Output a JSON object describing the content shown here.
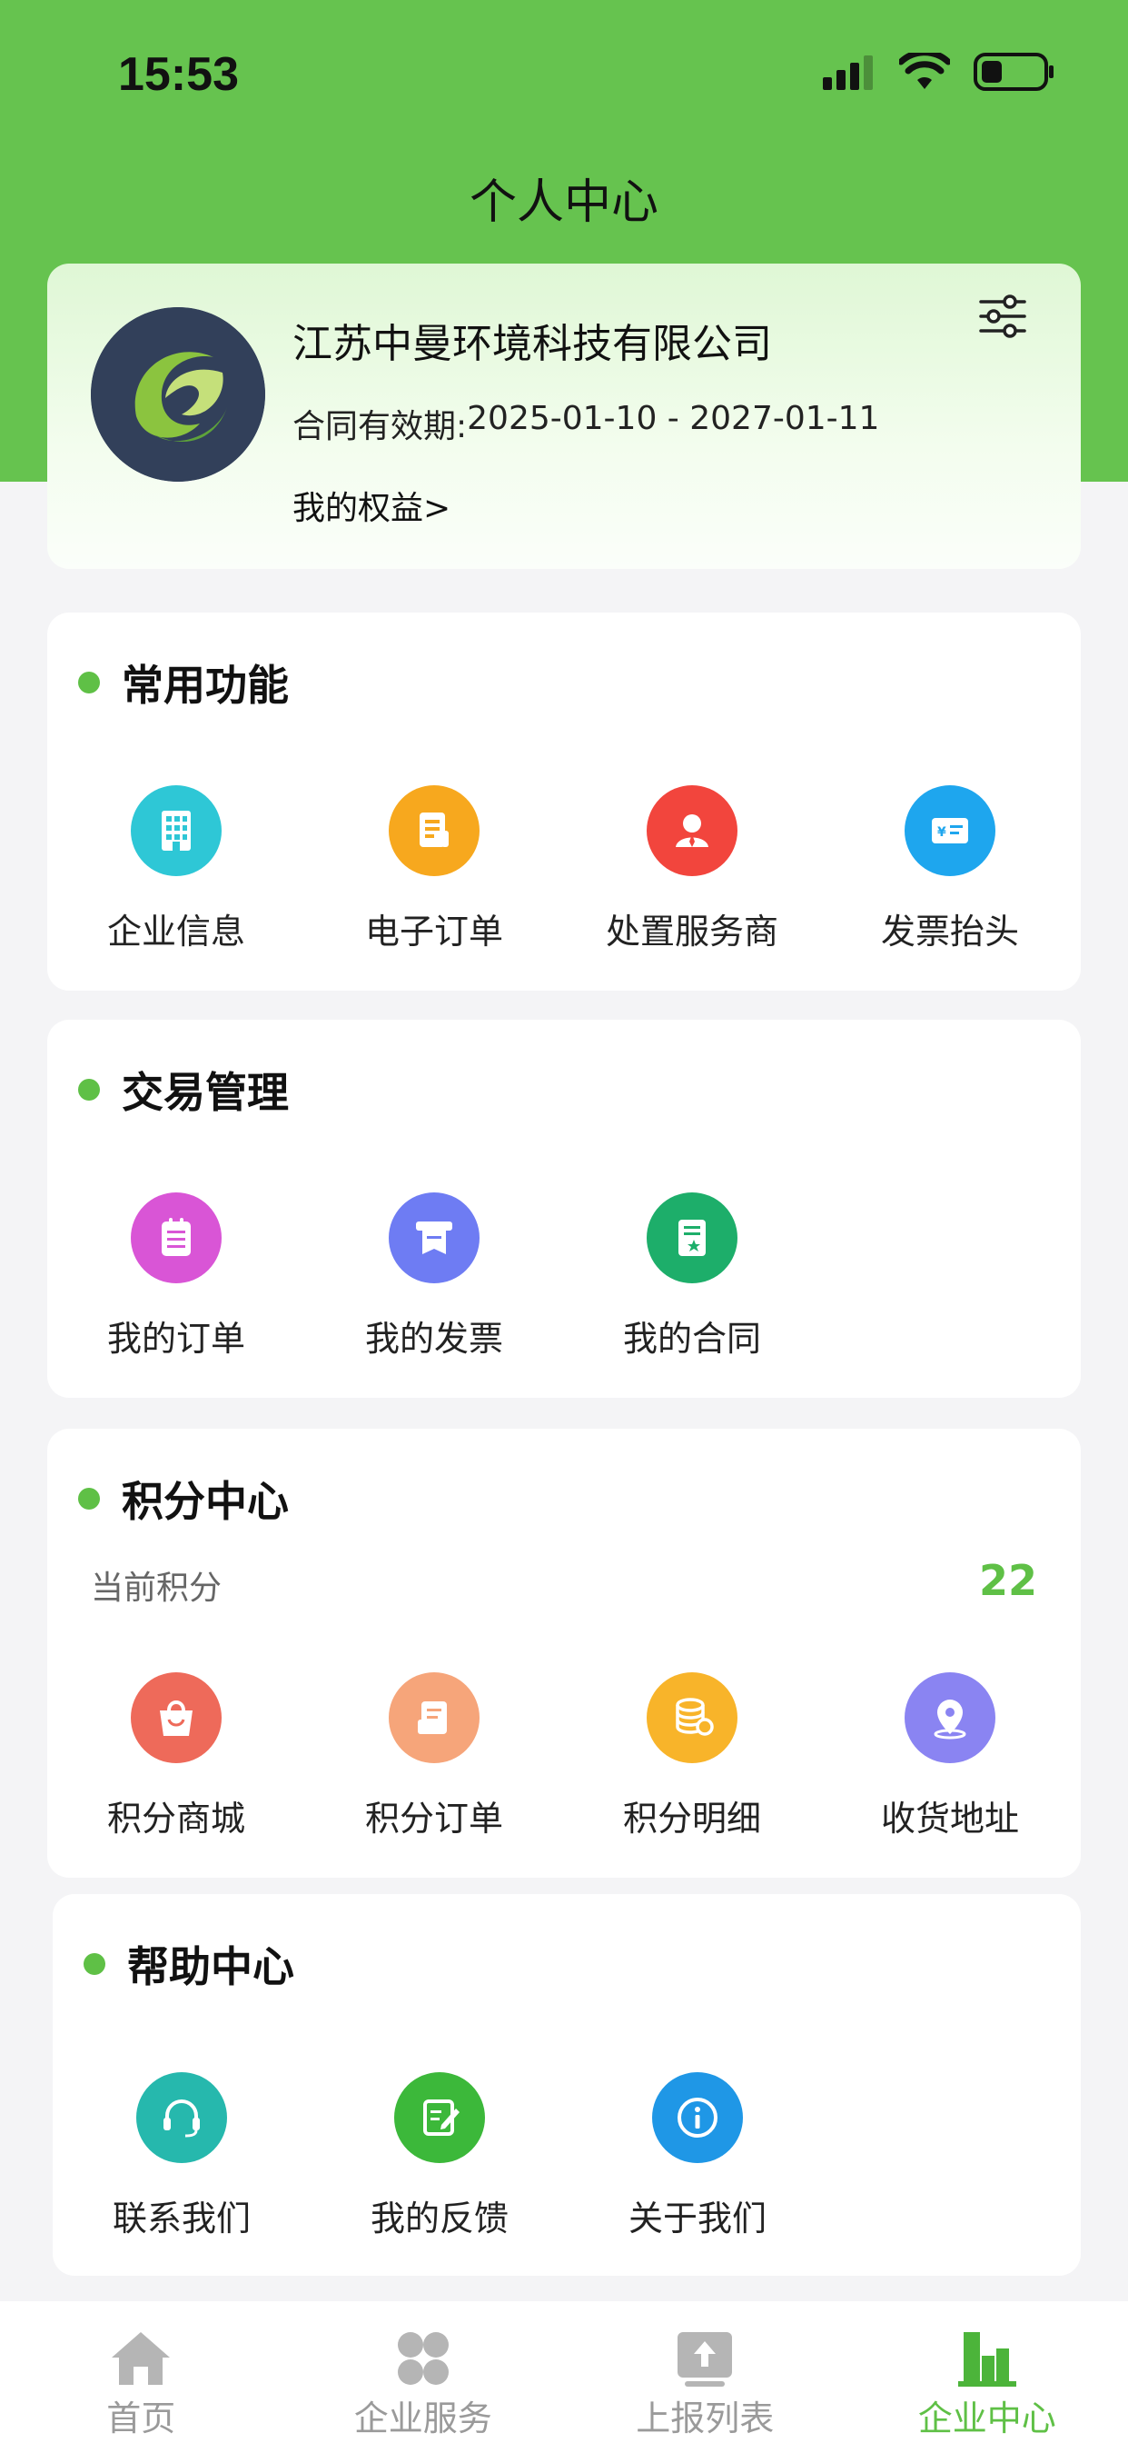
{
  "status_bar": {
    "time": "15:53"
  },
  "header": {
    "title": "个人中心"
  },
  "profile": {
    "company": "江苏中曼环境科技有限公司",
    "contract_label": "合同有效期:",
    "contract_range": "2025-01-10 - 2027-01-11",
    "rights_link": "我的权益>"
  },
  "sections": {
    "common": {
      "title": "常用功能",
      "items": [
        {
          "label": "企业信息",
          "icon": "building-icon",
          "color": "#2ec7d6"
        },
        {
          "label": "电子订单",
          "icon": "document-icon",
          "color": "#f7a81e"
        },
        {
          "label": "处置服务商",
          "icon": "person-icon",
          "color": "#f2453d"
        },
        {
          "label": "发票抬头",
          "icon": "invoice-icon",
          "color": "#1ea6ee"
        }
      ]
    },
    "trade": {
      "title": "交易管理",
      "items": [
        {
          "label": "我的订单",
          "icon": "clipboard-icon",
          "color": "#d955d6"
        },
        {
          "label": "我的发票",
          "icon": "receipt-icon",
          "color": "#6e7cf3"
        },
        {
          "label": "我的合同",
          "icon": "contract-icon",
          "color": "#1dae6a"
        }
      ]
    },
    "points": {
      "title": "积分中心",
      "current_label": "当前积分",
      "current_value": "22",
      "items": [
        {
          "label": "积分商城",
          "icon": "shopping-bag-icon",
          "color": "#ee6a5a"
        },
        {
          "label": "积分订单",
          "icon": "order-icon",
          "color": "#f6a57a"
        },
        {
          "label": "积分明细",
          "icon": "coins-icon",
          "color": "#f8b42a"
        },
        {
          "label": "收货地址",
          "icon": "location-icon",
          "color": "#8a84f2"
        }
      ]
    },
    "help": {
      "title": "帮助中心",
      "items": [
        {
          "label": "联系我们",
          "icon": "headset-icon",
          "color": "#26b8ad"
        },
        {
          "label": "我的反馈",
          "icon": "feedback-icon",
          "color": "#3cb83a"
        },
        {
          "label": "关于我们",
          "icon": "info-icon",
          "color": "#1f97e6"
        }
      ]
    }
  },
  "tabbar": {
    "items": [
      {
        "label": "首页",
        "icon": "home-icon"
      },
      {
        "label": "企业服务",
        "icon": "services-icon"
      },
      {
        "label": "上报列表",
        "icon": "upload-icon"
      },
      {
        "label": "企业中心",
        "icon": "enterprise-icon"
      }
    ],
    "active_index": 3
  },
  "colors": {
    "brand": "#66c34f",
    "accent": "#5fc046",
    "inactive": "#9a9a9a"
  }
}
